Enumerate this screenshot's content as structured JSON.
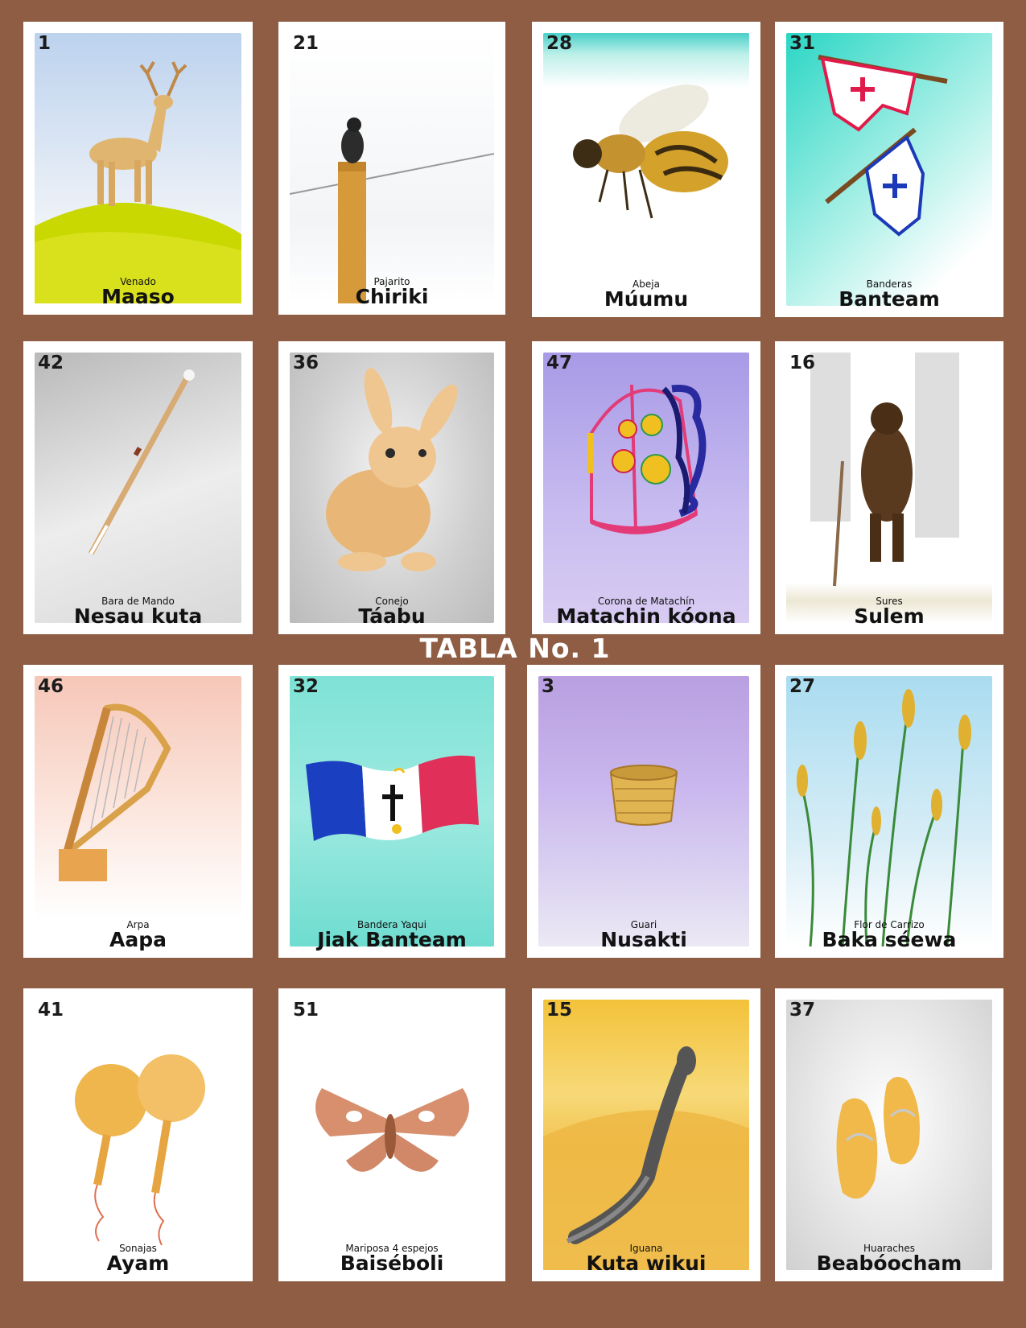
{
  "board_title": "TABLA No. 1",
  "cards": [
    {
      "number": "1",
      "spanish": "Venado",
      "yaqui": "Maaso",
      "icon": "deer-icon"
    },
    {
      "number": "21",
      "spanish": "Pajarito",
      "yaqui": "Chiriki",
      "icon": "bird-icon"
    },
    {
      "number": "28",
      "spanish": "Abeja",
      "yaqui": "Múumu",
      "icon": "bee-icon"
    },
    {
      "number": "31",
      "spanish": "Banderas",
      "yaqui": "Banteam",
      "icon": "flags-icon"
    },
    {
      "number": "42",
      "spanish": "Bara de Mando",
      "yaqui": "Nesau kuta",
      "icon": "staff-icon"
    },
    {
      "number": "36",
      "spanish": "Conejo",
      "yaqui": "Táabu",
      "icon": "rabbit-icon"
    },
    {
      "number": "47",
      "spanish": "Corona de Matachín",
      "yaqui": "Matachin kóona",
      "icon": "crown-icon"
    },
    {
      "number": "16",
      "spanish": "Sures",
      "yaqui": "Sulem",
      "icon": "ancestor-icon"
    },
    {
      "number": "46",
      "spanish": "Arpa",
      "yaqui": "Aapa",
      "icon": "harp-icon"
    },
    {
      "number": "32",
      "spanish": "Bandera Yaqui",
      "yaqui": "Jiak Banteam",
      "icon": "yaqui-flag-icon"
    },
    {
      "number": "3",
      "spanish": "Guari",
      "yaqui": "Nusakti",
      "icon": "basket-icon"
    },
    {
      "number": "27",
      "spanish": "Flor de Carrizo",
      "yaqui": "Baka séewa",
      "icon": "reed-icon"
    },
    {
      "number": "41",
      "spanish": "Sonajas",
      "yaqui": "Ayam",
      "icon": "rattles-icon"
    },
    {
      "number": "51",
      "spanish": "Mariposa 4 espejos",
      "yaqui": "Baiséboli",
      "icon": "moth-icon"
    },
    {
      "number": "15",
      "spanish": "Iguana",
      "yaqui": "Kuta wikui",
      "icon": "iguana-icon"
    },
    {
      "number": "37",
      "spanish": "Huaraches",
      "yaqui": "Beabóocham",
      "icon": "sandals-icon"
    }
  ]
}
